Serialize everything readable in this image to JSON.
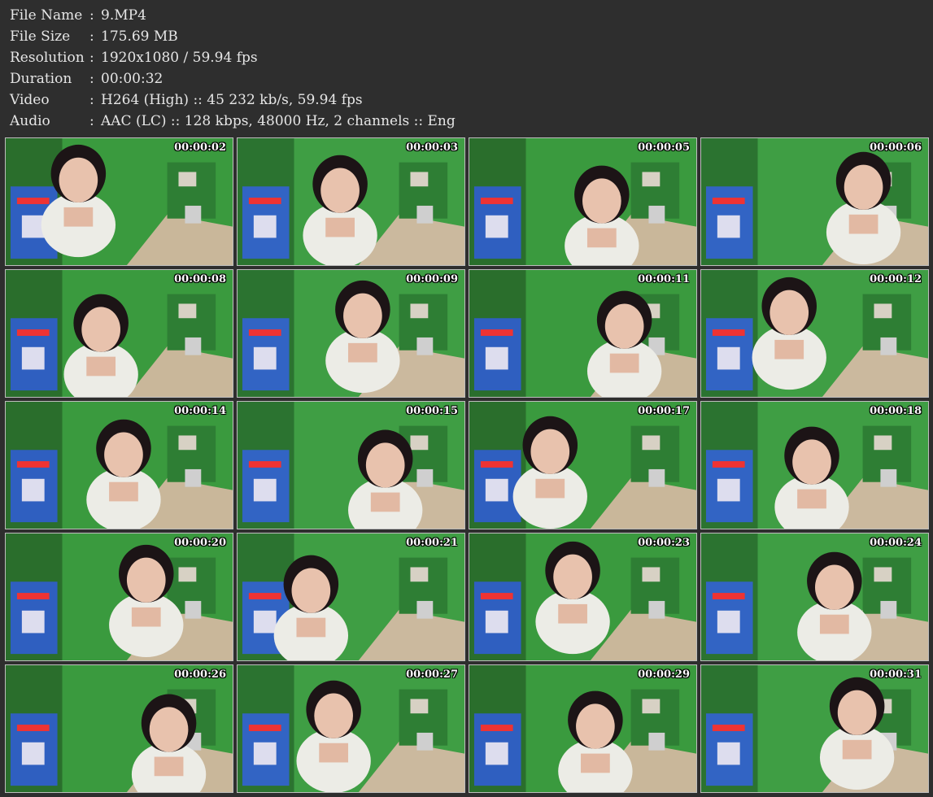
{
  "info": [
    {
      "key": "File Name",
      "sep": ":",
      "value": "9.MP4"
    },
    {
      "key": "File Size",
      "sep": ":",
      "value": "175.69 MB"
    },
    {
      "key": "Resolution",
      "sep": ":",
      "value": "1920x1080 / 59.94 fps"
    },
    {
      "key": "Duration",
      "sep": ":",
      "value": "00:00:32"
    },
    {
      "key": "Video",
      "sep": ":",
      "value": "H264 (High) :: 45 232 kb/s, 59.94 fps"
    },
    {
      "key": "Audio",
      "sep": ":",
      "value": "AAC (LC) :: 128 kbps, 48000 Hz, 2 channels :: Eng"
    }
  ],
  "thumbs": [
    {
      "ts": "00:00:02"
    },
    {
      "ts": "00:00:03"
    },
    {
      "ts": "00:00:05"
    },
    {
      "ts": "00:00:06"
    },
    {
      "ts": "00:00:08"
    },
    {
      "ts": "00:00:09"
    },
    {
      "ts": "00:00:11"
    },
    {
      "ts": "00:00:12"
    },
    {
      "ts": "00:00:14"
    },
    {
      "ts": "00:00:15"
    },
    {
      "ts": "00:00:17"
    },
    {
      "ts": "00:00:18"
    },
    {
      "ts": "00:00:20"
    },
    {
      "ts": "00:00:21"
    },
    {
      "ts": "00:00:23"
    },
    {
      "ts": "00:00:24"
    },
    {
      "ts": "00:00:26"
    },
    {
      "ts": "00:00:27"
    },
    {
      "ts": "00:00:29"
    },
    {
      "ts": "00:00:31"
    }
  ]
}
